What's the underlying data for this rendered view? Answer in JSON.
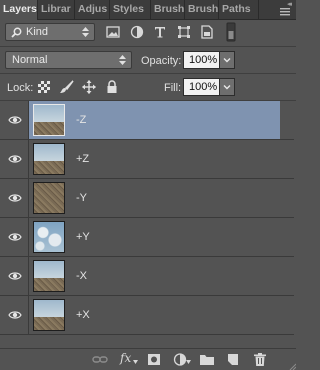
{
  "tabs": [
    {
      "label": "Layers",
      "active": true
    },
    {
      "label": "Librar",
      "active": false
    },
    {
      "label": "Adjus",
      "active": false
    },
    {
      "label": "Styles",
      "active": false
    },
    {
      "label": "Brush",
      "active": false
    },
    {
      "label": "Brush",
      "active": false
    },
    {
      "label": "Paths",
      "active": false
    }
  ],
  "collapse_glyph": "◂◂",
  "filter": {
    "kind_label": "Kind",
    "icons": [
      "image-filter-icon",
      "adjustment-filter-icon",
      "type-filter-icon",
      "shape-filter-icon",
      "smart-object-filter-icon",
      "filter-toggle-icon"
    ]
  },
  "blend": {
    "mode": "Normal",
    "opacity_label": "Opacity:",
    "opacity_value": "100%"
  },
  "lock": {
    "label": "Lock:",
    "icons": [
      "lock-transparent-pixels-icon",
      "lock-image-pixels-icon",
      "lock-position-icon",
      "lock-all-icon"
    ],
    "fill_label": "Fill:",
    "fill_value": "100%"
  },
  "layers": [
    {
      "name": "-Z",
      "selected": true,
      "thumb": "horizon"
    },
    {
      "name": "+Z",
      "selected": false,
      "thumb": "horizon"
    },
    {
      "name": "-Y",
      "selected": false,
      "thumb": "ground"
    },
    {
      "name": "+Y",
      "selected": false,
      "thumb": "sky"
    },
    {
      "name": "-X",
      "selected": false,
      "thumb": "horizon"
    },
    {
      "name": "+X",
      "selected": false,
      "thumb": "horizon"
    }
  ],
  "bottom_icons": [
    "link-layers-icon",
    "add-layer-style-icon",
    "add-mask-icon",
    "new-adjustment-layer-icon",
    "new-group-icon",
    "new-layer-icon",
    "delete-layer-icon"
  ],
  "fx_label": "fx",
  "colors": {
    "panel_bg": "#535353",
    "selected_row": "#7f93b0",
    "tab_bar": "#3c3c3c"
  }
}
